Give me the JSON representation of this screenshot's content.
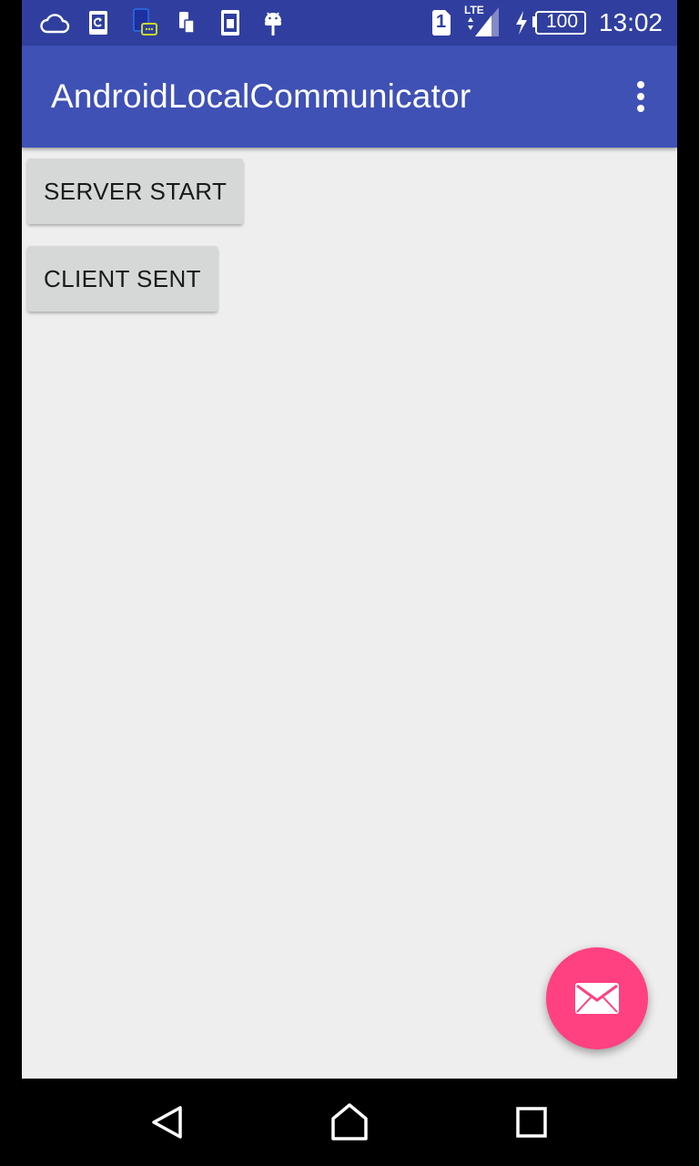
{
  "status_bar": {
    "time": "13:02",
    "battery_level": "100",
    "network_type": "LTE",
    "sim_slot": "1",
    "icons": [
      "cloud-icon",
      "sync-icon",
      "message-notification-icon",
      "phone-sd-icon",
      "phone-storage-icon",
      "android-debug-icon",
      "sim-icon",
      "signal-icon",
      "charging-icon",
      "battery-icon"
    ]
  },
  "app_bar": {
    "title": "AndroidLocalCommunicator",
    "menu_icon": "more-vert-icon"
  },
  "main": {
    "server_start_label": "SERVER START",
    "client_sent_label": "CLIENT SENT"
  },
  "fab": {
    "icon": "email-icon"
  },
  "nav_bar": {
    "icons": [
      "back-icon",
      "home-icon",
      "recents-icon"
    ]
  },
  "colors": {
    "status_bar": "#303f9f",
    "app_bar": "#3f51b5",
    "accent": "#ff4081",
    "background": "#eeeeee",
    "button": "#d6d7d7"
  }
}
